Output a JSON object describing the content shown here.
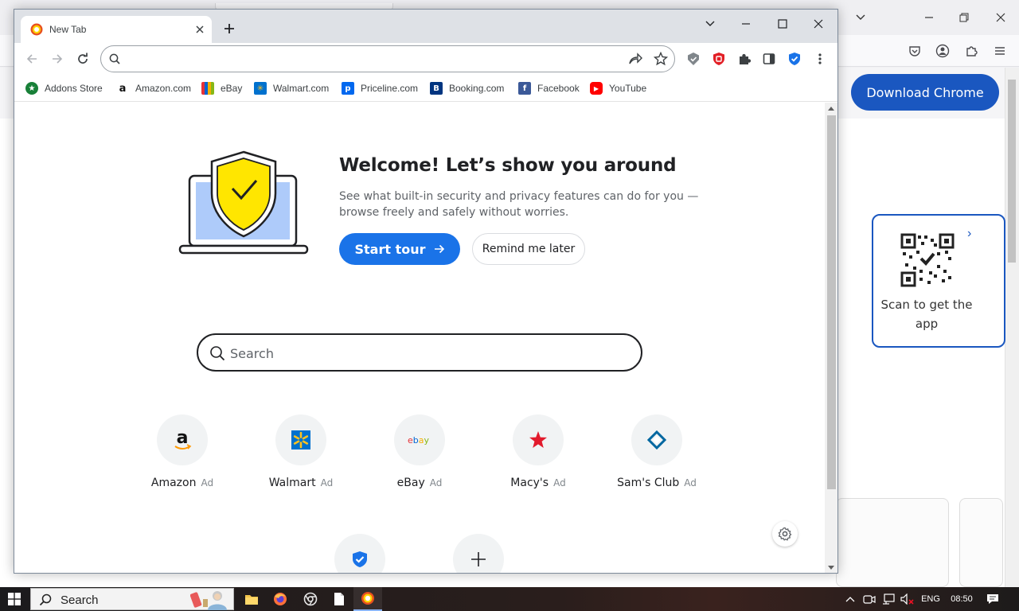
{
  "browser": {
    "tab": {
      "title": "New Tab",
      "close_symbol": "✕",
      "new_tab_symbol": "+"
    },
    "omnibox": {
      "value": "",
      "placeholder": ""
    },
    "bookmarks": [
      {
        "label": "Addons Store",
        "icon": "addons-store-icon",
        "color": "#188038"
      },
      {
        "label": "Amazon.com",
        "icon": "amazon-icon",
        "color": "#ffffff"
      },
      {
        "label": "eBay",
        "icon": "ebay-icon",
        "color": "#e53238"
      },
      {
        "label": "Walmart.com",
        "icon": "walmart-icon",
        "color": "#0071ce"
      },
      {
        "label": "Priceline.com",
        "icon": "priceline-icon",
        "color": "#0068ef"
      },
      {
        "label": "Booking.com",
        "icon": "booking-icon",
        "color": "#003580"
      },
      {
        "label": "Facebook",
        "icon": "facebook-icon",
        "color": "#3b5998"
      },
      {
        "label": "YouTube",
        "icon": "youtube-icon",
        "color": "#ff0000"
      }
    ]
  },
  "welcome": {
    "title": "Welcome! Let’s show you around",
    "description": "See what built-in security and privacy features can do for you — browse freely and safely without worries.",
    "start_tour_label": "Start tour",
    "remind_label": "Remind me later"
  },
  "search": {
    "placeholder": "Search"
  },
  "shortcuts": [
    {
      "label": "Amazon",
      "badge": "Ad",
      "icon": "amazon-icon"
    },
    {
      "label": "Walmart",
      "badge": "Ad",
      "icon": "walmart-icon"
    },
    {
      "label": "eBay",
      "badge": "Ad",
      "icon": "ebay-icon"
    },
    {
      "label": "Macy's",
      "badge": "Ad",
      "icon": "macys-star-icon"
    },
    {
      "label": "Sam's Club",
      "badge": "Ad",
      "icon": "sams-club-icon"
    }
  ],
  "background_page": {
    "download_label": "Download Chrome",
    "qr_text": "Scan to get the app",
    "accent": "#1a57c0"
  },
  "taskbar": {
    "search_label": "Search",
    "language": "ENG",
    "time": "08:50"
  },
  "colors": {
    "accent": "#1a73e8",
    "shield_yellow": "#ffe600",
    "laptop_screen": "#aecbfa"
  }
}
